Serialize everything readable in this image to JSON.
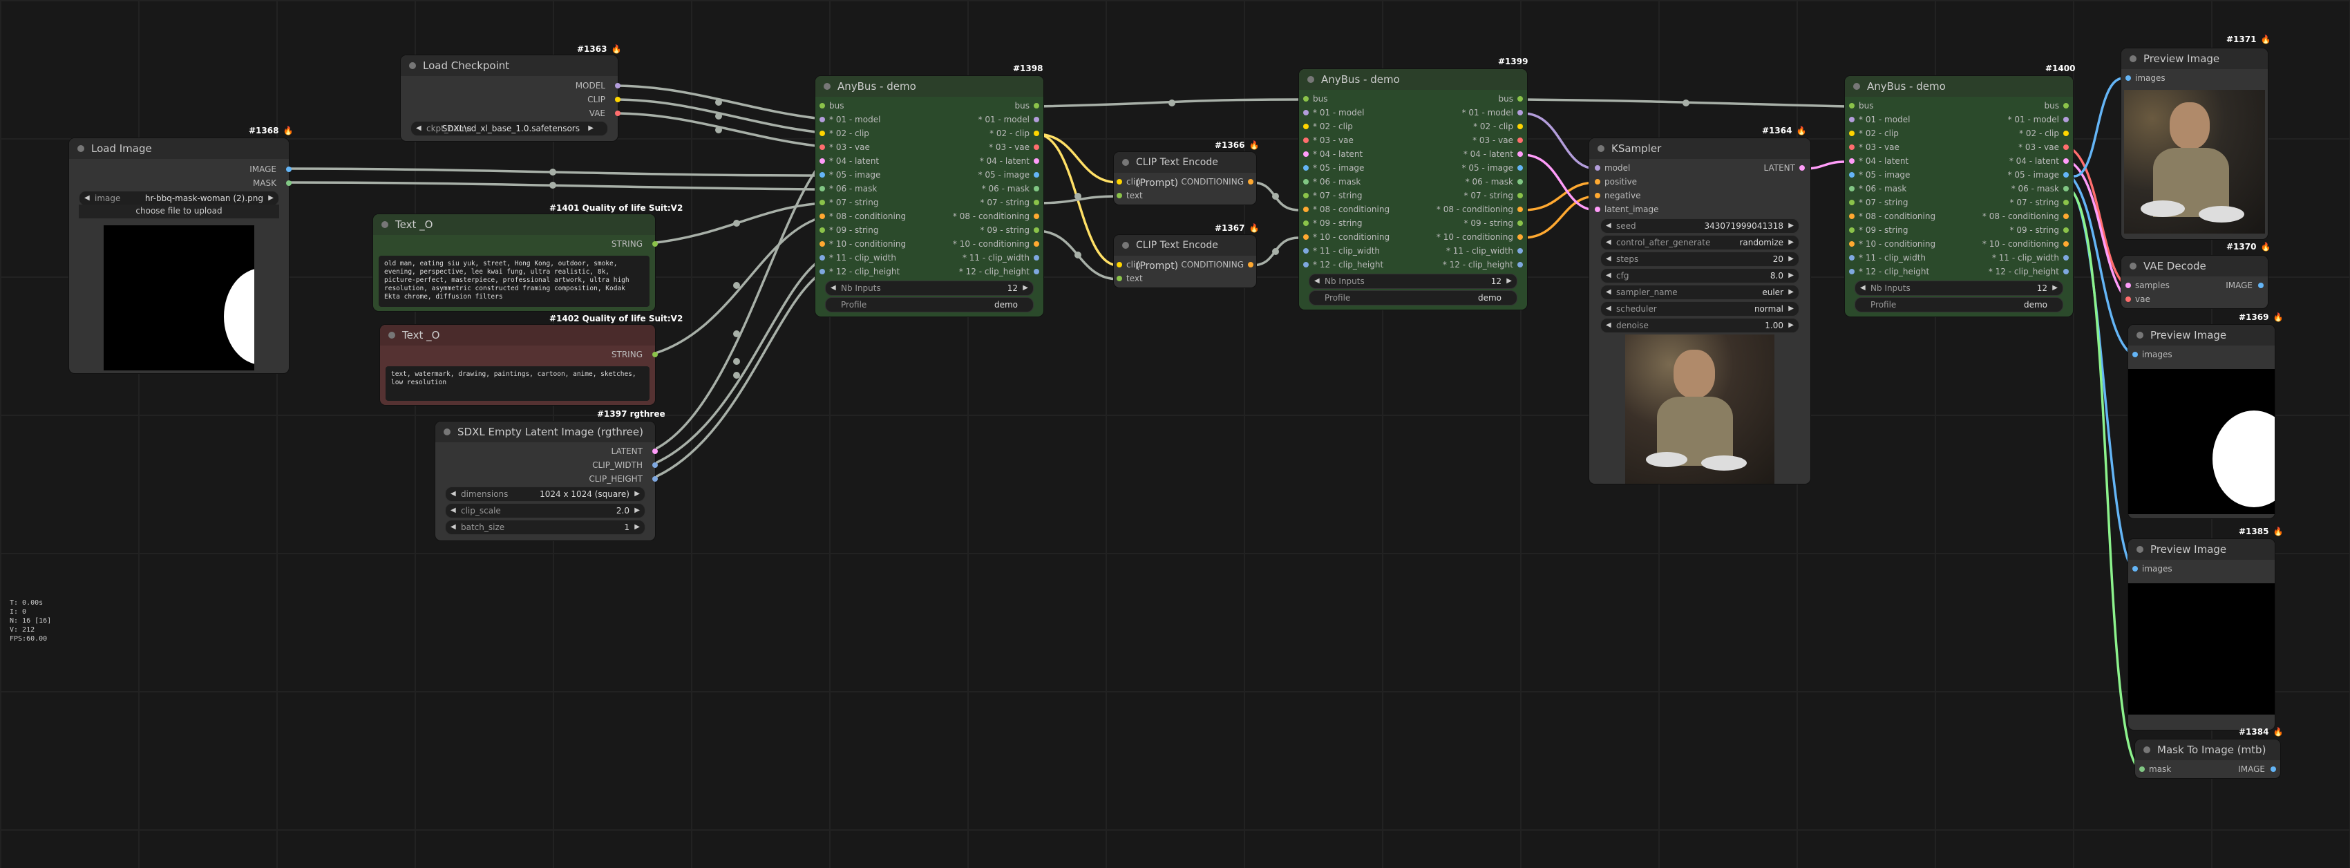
{
  "stats": [
    "T: 0.00s",
    "I: 0",
    "N: 16 [16]",
    "V: 212",
    "FPS:60.00"
  ],
  "nodes": {
    "load_image": {
      "id": "#1368",
      "title": "Load Image",
      "outputs": [
        "IMAGE",
        "MASK"
      ],
      "image_label": "image",
      "image_value": "hr-bbq-mask-woman (2).png",
      "upload_label": "choose file to upload"
    },
    "load_checkpoint": {
      "id": "#1363",
      "title": "Load Checkpoint",
      "outputs": [
        "MODEL",
        "CLIP",
        "VAE"
      ],
      "ckpt_label": "ckpt_name",
      "ckpt_value": "SDXL\\sd_xl_base_1.0.safetensors"
    },
    "text_pos": {
      "id": "#1401 Quality of life Suit:V2",
      "title": "Text _O",
      "output": "STRING",
      "text": "old man, eating siu yuk, street, Hong Kong, outdoor, smoke, evening, perspective, lee kwai fung, ultra realistic, 8k, picture-perfect, masterpiece, professional artwork, ultra high resolution, asymmetric constructed framing composition, Kodak Ekta chrome, diffusion filters"
    },
    "text_neg": {
      "id": "#1402 Quality of life Suit:V2",
      "title": "Text _O",
      "output": "STRING",
      "text": "text, watermark, drawing, paintings, cartoon, anime, sketches, low resolution"
    },
    "sdxl_latent": {
      "id": "#1397 rgthree",
      "title": "SDXL Empty Latent Image (rgthree)",
      "outputs": [
        "LATENT",
        "CLIP_WIDTH",
        "CLIP_HEIGHT"
      ],
      "widgets": [
        {
          "label": "dimensions",
          "value": "1024 x 1024  (square)"
        },
        {
          "label": "clip_scale",
          "value": "2.0"
        },
        {
          "label": "batch_size",
          "value": "1"
        }
      ]
    },
    "anybus1": {
      "id": "#1398",
      "title": "AnyBus - demo",
      "rows_in": [
        "bus",
        "* 01 - model",
        "* 02 - clip",
        "* 03 - vae",
        "* 04 - latent",
        "* 05 - image",
        "* 06 - mask",
        "* 07 - string",
        "* 08 - conditioning",
        "* 09 - string",
        "* 10 - conditioning",
        "* 11 - clip_width",
        "* 12 - clip_height"
      ],
      "rows_out": [
        "bus",
        "* 01 - model",
        "* 02 - clip",
        "* 03 - vae",
        "* 04 - latent",
        "* 05 - image",
        "* 06 - mask",
        "* 07 - string",
        "* 08 - conditioning",
        "* 09 - string",
        "* 10 - conditioning",
        "* 11 - clip_width",
        "* 12 - clip_height"
      ],
      "nb_label": "Nb Inputs",
      "nb_value": "12",
      "profile_label": "Profile",
      "profile_value": "demo"
    },
    "clip1": {
      "id": "#1366",
      "title": "CLIP Text Encode (Prompt)",
      "inputs": [
        "clip",
        "text"
      ],
      "output": "CONDITIONING"
    },
    "clip2": {
      "id": "#1367",
      "title": "CLIP Text Encode (Prompt)",
      "inputs": [
        "clip",
        "text"
      ],
      "output": "CONDITIONING"
    },
    "anybus2": {
      "id": "#1399",
      "title": "AnyBus - demo",
      "nb_label": "Nb Inputs",
      "nb_value": "12",
      "profile_label": "Profile",
      "profile_value": "demo"
    },
    "ksampler": {
      "id": "#1364",
      "title": "KSampler",
      "inputs": [
        "model",
        "positive",
        "negative",
        "latent_image"
      ],
      "output": "LATENT",
      "widgets": [
        {
          "label": "seed",
          "value": "343071999041318"
        },
        {
          "label": "control_after_generate",
          "value": "randomize"
        },
        {
          "label": "steps",
          "value": "20"
        },
        {
          "label": "cfg",
          "value": "8.0"
        },
        {
          "label": "sampler_name",
          "value": "euler"
        },
        {
          "label": "scheduler",
          "value": "normal"
        },
        {
          "label": "denoise",
          "value": "1.00"
        }
      ]
    },
    "anybus3": {
      "id": "#1400",
      "title": "AnyBus - demo",
      "nb_label": "Nb Inputs",
      "nb_value": "12",
      "profile_label": "Profile",
      "profile_value": "demo"
    },
    "preview1": {
      "id": "#1371",
      "title": "Preview Image",
      "input": "images"
    },
    "vae_decode": {
      "id": "#1370",
      "title": "VAE Decode",
      "inputs": [
        "samples",
        "vae"
      ],
      "output": "IMAGE"
    },
    "preview2": {
      "id": "#1369",
      "title": "Preview Image",
      "input": "images"
    },
    "preview3": {
      "id": "#1385",
      "title": "Preview Image",
      "input": "images"
    },
    "mask_to_image": {
      "id": "#1384",
      "title": "Mask To Image (mtb)",
      "input": "mask",
      "output": "IMAGE"
    }
  },
  "colors": {
    "model": "#b39ddb",
    "clip": "#ffd500",
    "vae": "#ff6e6e",
    "latent": "#ff9cf9",
    "image": "#64b5f6",
    "mask": "#81c784",
    "string": "#8bc34a",
    "conditioning": "#ffa931",
    "int": "#7fa8e0",
    "bus": "#8bc34a"
  }
}
